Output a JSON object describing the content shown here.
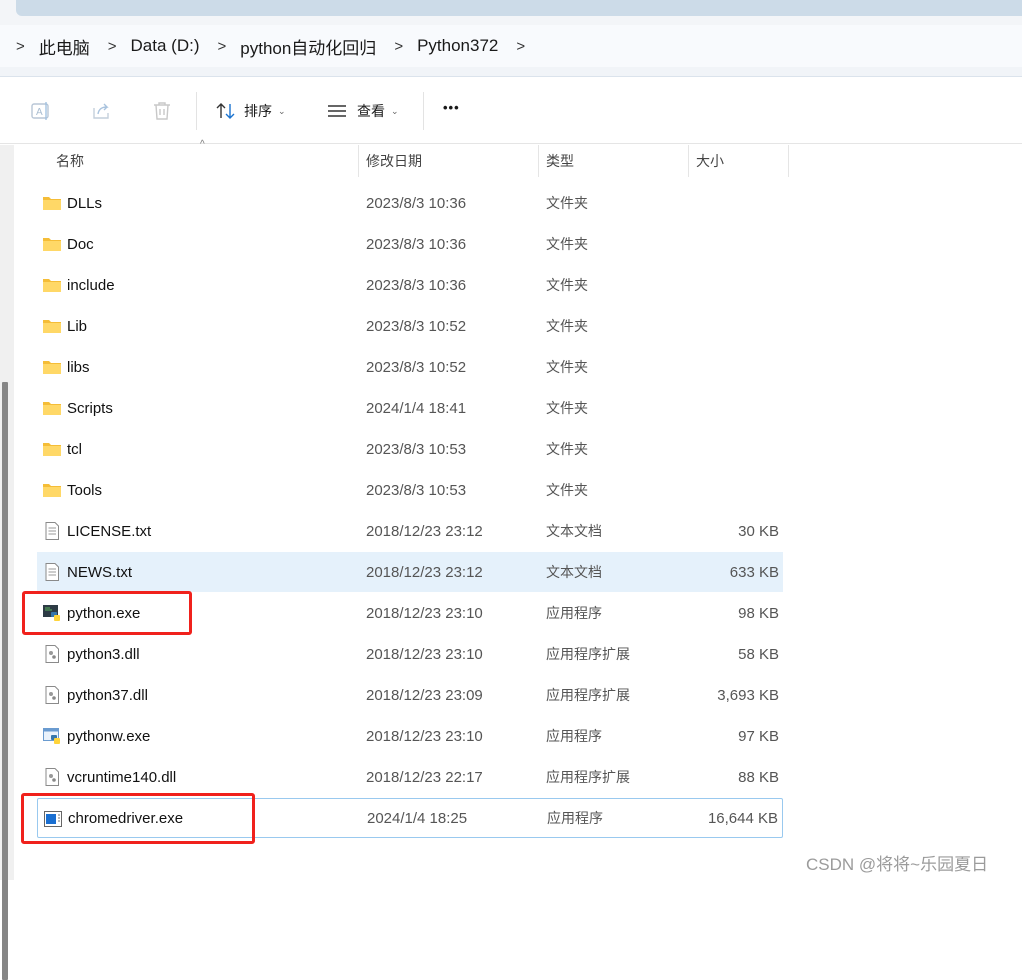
{
  "breadcrumb": [
    "此电脑",
    "Data (D:)",
    "python自动化回归",
    "Python372"
  ],
  "toolbar": {
    "sort_label": "排序",
    "view_label": "查看",
    "more_label": "•••"
  },
  "columns": {
    "name": "名称",
    "date": "修改日期",
    "type": "类型",
    "size": "大小"
  },
  "files": [
    {
      "name": "DLLs",
      "date": "2023/8/3 10:36",
      "type": "文件夹",
      "size": "",
      "icon": "folder"
    },
    {
      "name": "Doc",
      "date": "2023/8/3 10:36",
      "type": "文件夹",
      "size": "",
      "icon": "folder"
    },
    {
      "name": "include",
      "date": "2023/8/3 10:36",
      "type": "文件夹",
      "size": "",
      "icon": "folder"
    },
    {
      "name": "Lib",
      "date": "2023/8/3 10:52",
      "type": "文件夹",
      "size": "",
      "icon": "folder"
    },
    {
      "name": "libs",
      "date": "2023/8/3 10:52",
      "type": "文件夹",
      "size": "",
      "icon": "folder"
    },
    {
      "name": "Scripts",
      "date": "2024/1/4 18:41",
      "type": "文件夹",
      "size": "",
      "icon": "folder"
    },
    {
      "name": "tcl",
      "date": "2023/8/3 10:53",
      "type": "文件夹",
      "size": "",
      "icon": "folder"
    },
    {
      "name": "Tools",
      "date": "2023/8/3 10:53",
      "type": "文件夹",
      "size": "",
      "icon": "folder"
    },
    {
      "name": "LICENSE.txt",
      "date": "2018/12/23 23:12",
      "type": "文本文档",
      "size": "30 KB",
      "icon": "text"
    },
    {
      "name": "NEWS.txt",
      "date": "2018/12/23 23:12",
      "type": "文本文档",
      "size": "633 KB",
      "icon": "text"
    },
    {
      "name": "python.exe",
      "date": "2018/12/23 23:10",
      "type": "应用程序",
      "size": "98 KB",
      "icon": "python"
    },
    {
      "name": "python3.dll",
      "date": "2018/12/23 23:10",
      "type": "应用程序扩展",
      "size": "58 KB",
      "icon": "dll"
    },
    {
      "name": "python37.dll",
      "date": "2018/12/23 23:09",
      "type": "应用程序扩展",
      "size": "3,693 KB",
      "icon": "dll"
    },
    {
      "name": "pythonw.exe",
      "date": "2018/12/23 23:10",
      "type": "应用程序",
      "size": "97 KB",
      "icon": "pythonw"
    },
    {
      "name": "vcruntime140.dll",
      "date": "2018/12/23 22:17",
      "type": "应用程序扩展",
      "size": "88 KB",
      "icon": "dll"
    },
    {
      "name": "chromedriver.exe",
      "date": "2024/1/4 18:25",
      "type": "应用程序",
      "size": "16,644 KB",
      "icon": "app"
    }
  ],
  "watermark": "CSDN @将将~乐园夏日"
}
